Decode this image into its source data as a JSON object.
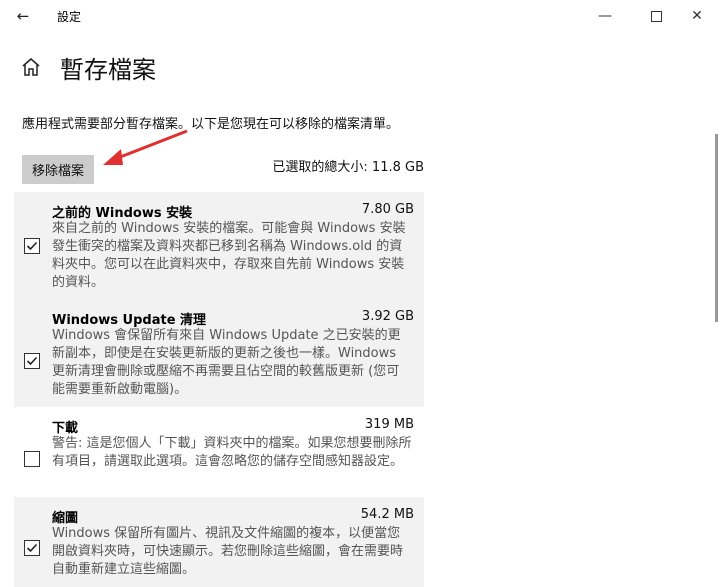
{
  "window": {
    "title": "設定",
    "back_icon": "←",
    "minimize_icon": "—",
    "close_icon": "✕"
  },
  "page": {
    "title": "暫存檔案",
    "description": "應用程式需要部分暫存檔案。以下是您現在可以移除的檔案清單。",
    "remove_button": "移除檔案",
    "total_selected": "已選取的總大小: 11.8 GB",
    "annotation_color": "#e03030"
  },
  "items": [
    {
      "name": "之前的 Windows 安裝",
      "size": "7.80 GB",
      "checked": true,
      "description": "來自之前的 Windows 安裝的檔案。可能會與 Windows 安裝發生衝突的檔案及資料夾都已移到名稱為 Windows.old 的資料夾中。您可以在此資料夾中，存取來自先前 Windows 安裝的資料。"
    },
    {
      "name": "Windows Update 清理",
      "size": "3.92 GB",
      "checked": true,
      "description": "Windows 會保留所有來自 Windows Update 之已安裝的更新副本，即使是在安裝更新版的更新之後也一樣。Windows 更新清理會刪除或壓縮不再需要且佔空間的較舊版更新 (您可能需要重新啟動電腦)。"
    },
    {
      "name": "下載",
      "size": "319 MB",
      "checked": false,
      "description": "警告: 這是您個人「下載」資料夾中的檔案。如果您想要刪除所有項目，請選取此選項。這會忽略您的儲存空間感知器設定。"
    },
    {
      "name": "縮圖",
      "size": "54.2 MB",
      "checked": true,
      "description": "Windows 保留所有圖片、視訊及文件縮圖的複本，以便當您開啟資料夾時，可快速顯示。若您刪除這些縮圖，會在需要時自動重新建立這些縮圖。"
    }
  ]
}
